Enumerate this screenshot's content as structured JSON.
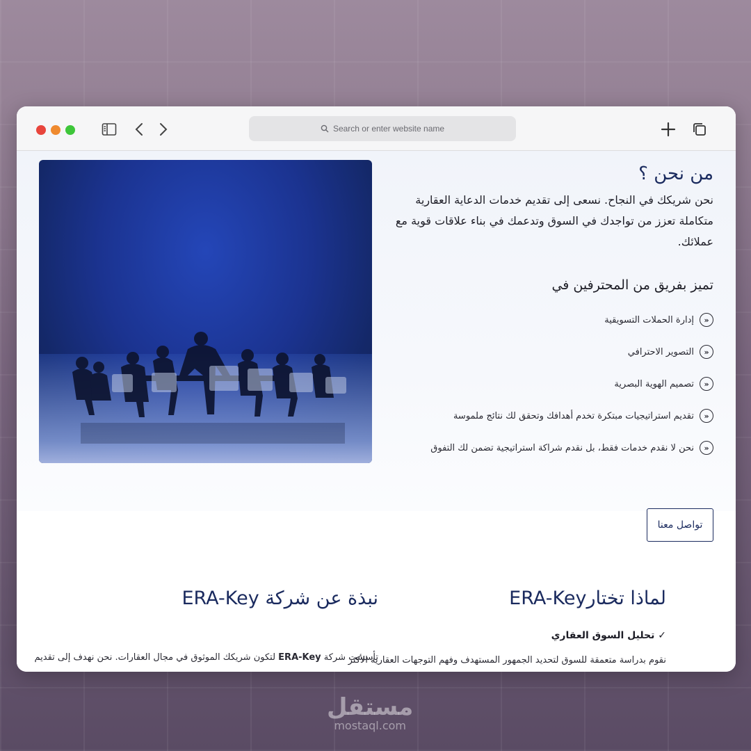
{
  "browser": {
    "address_placeholder": "Search or enter website name"
  },
  "about": {
    "title": "من نحن ؟",
    "lead": "نحن شريكك في النجاح. نسعى إلى تقديم خدمات الدعاية العقارية متكاملة تعزز من تواجدك في السوق وتدعمك في بناء علاقات قوية مع عملائك.",
    "team_heading": "تميز بفريق من المحترفين في",
    "features": [
      "إدارة الحملات التسويقية",
      "التصوير الاحترافي",
      "تصميم الهوية البصرية",
      "تقديم استراتيجيات مبتكرة تخدم أهدافك وتحقق لك نتائج ملموسة",
      "نحن لا نقدم خدمات فقط، بل نقدم شراكة استراتيجية تضمن لك التفوق"
    ],
    "cta_label": "تواصل معنا"
  },
  "why": {
    "title": "لماذا تختارERA-Key",
    "item_title": "✓ تحليل السوق العقاري",
    "item_text": "نقوم بدراسة متعمقة للسوق لتحديد الجمهور المستهدف وفهم التوجهات العقارية الأكثر"
  },
  "company": {
    "title": "نبذة عن شركة ERA-Key",
    "text_prefix": "تأسست شركة",
    "text_brand": "ERA-Key",
    "text_suffix": "لتكون شريكك الموثوق في مجال العقارات. نحن نهدف إلى تقديم"
  },
  "watermark": {
    "arabic": "مستقل",
    "latin": "mostaql.com"
  },
  "colors": {
    "brand_navy": "#1a2a5e",
    "hero_blue": "#1b3390"
  }
}
